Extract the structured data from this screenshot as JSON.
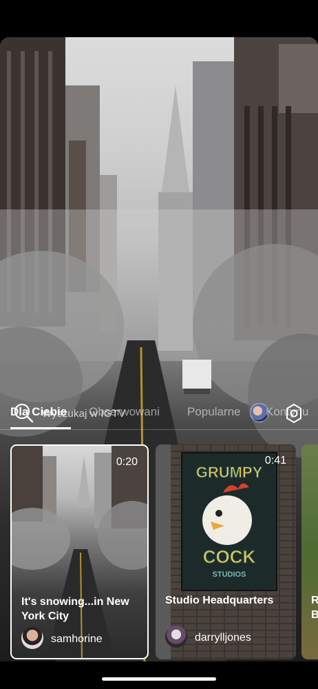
{
  "search": {
    "placeholder": "Wyszukaj w IGTV"
  },
  "tabs": [
    {
      "label": "Dla Ciebie",
      "active": true
    },
    {
      "label": "Obserwowani",
      "active": false
    },
    {
      "label": "Popularne",
      "active": false
    },
    {
      "label": "Kontynu",
      "active": false
    }
  ],
  "cards": [
    {
      "duration": "0:20",
      "title": "It's snowing...in New York City",
      "username": "samhorine",
      "selected": true
    },
    {
      "duration": "0:41",
      "title": "Studio Headquarters",
      "username": "darrylljones",
      "selected": false
    },
    {
      "duration": "",
      "title": "R B",
      "username": "",
      "selected": false
    }
  ],
  "poster": {
    "line1": "GRUMPY",
    "line2": "COCK",
    "line3": "STUDIOS"
  },
  "icons": {
    "search": "search-icon",
    "profile": "avatar-icon",
    "settings": "gear-icon"
  },
  "colors": {
    "accent": "#ffffff",
    "inactive_tab": "#8c8c8c"
  }
}
